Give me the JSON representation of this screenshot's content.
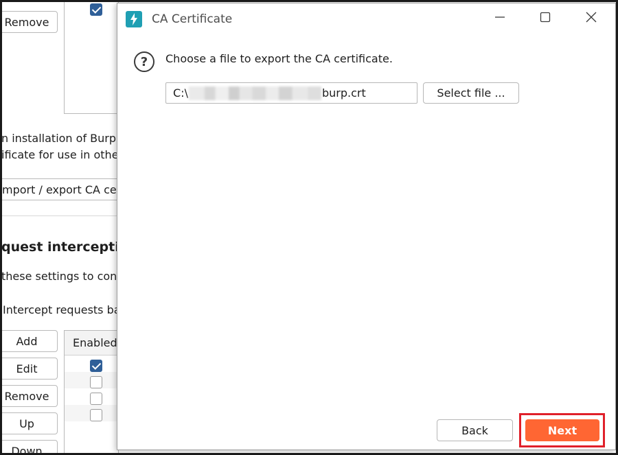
{
  "background": {
    "buttons_top": {
      "remove": "Remove"
    },
    "description_line1": "n installation of Burp",
    "description_line2": "ificate for use in othe",
    "import_export_button": "mport / export CA cer",
    "section_heading": "quest interception",
    "section_desc": " these settings to con",
    "intercept_label": "Intercept requests ba",
    "rule_buttons": {
      "add": "Add",
      "edit": "Edit",
      "remove": "Remove",
      "up": "Up",
      "down": "Down"
    },
    "table_header_enabled": "Enabled",
    "table_rows_enabled": [
      true,
      false,
      false,
      false
    ],
    "top_checkbox_checked": true
  },
  "dialog": {
    "title": "CA Certificate",
    "prompt": "Choose a file to export the CA certificate.",
    "path_prefix": "C:\\",
    "path_suffix": "burp.crt",
    "select_file_label": "Select file ...",
    "back_label": "Back",
    "next_label": "Next",
    "next_color": "#ff6633",
    "highlight_color": "#e0202a",
    "app_icon_color": "#1f9fb3"
  }
}
